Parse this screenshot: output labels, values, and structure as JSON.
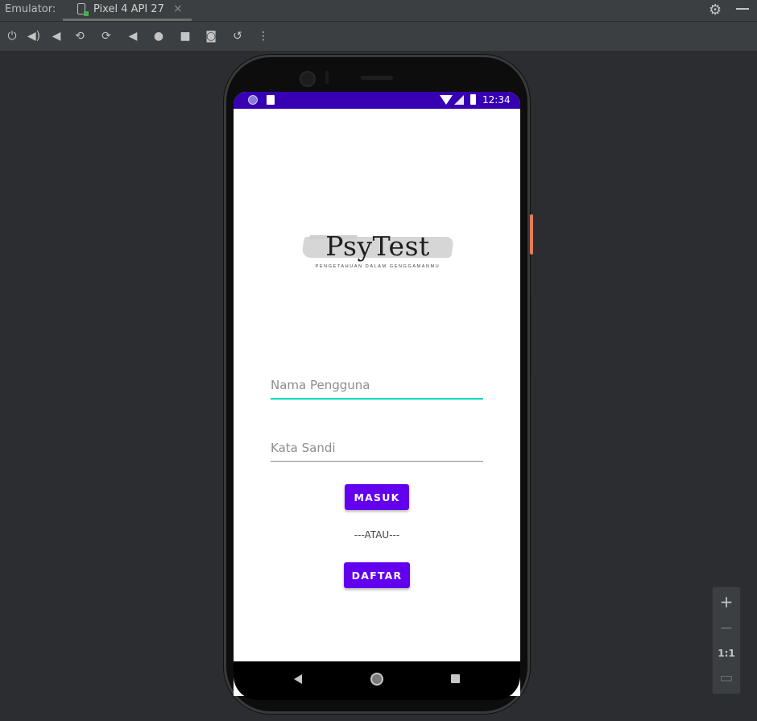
{
  "ide": {
    "panel_label": "Emulator:",
    "tab_name": "Pixel 4 API 27",
    "tab_close": "×",
    "settings_icon": "gear-icon",
    "minimize_icon": "minimize-icon"
  },
  "toolbar": {
    "items": [
      {
        "name": "power-icon",
        "glyph": "⏻"
      },
      {
        "name": "volume-up-icon",
        "glyph": "🔊"
      },
      {
        "name": "volume-down-icon",
        "glyph": "🔉"
      },
      {
        "name": "rotate-left-icon",
        "glyph": "⟲"
      },
      {
        "name": "rotate-right-icon",
        "glyph": "⟳"
      },
      {
        "name": "back-icon",
        "glyph": "◀"
      },
      {
        "name": "home-icon",
        "glyph": "●"
      },
      {
        "name": "overview-icon",
        "glyph": "■"
      },
      {
        "name": "screenshot-icon",
        "glyph": "📷"
      },
      {
        "name": "snapshot-icon",
        "glyph": "↺"
      },
      {
        "name": "more-icon",
        "glyph": "⋮"
      }
    ]
  },
  "device": {
    "status_time": "12:34",
    "app": {
      "logo_title": "PsyTest",
      "logo_subtitle": "PENGETAHUAN DALAM GENGGAMANMU",
      "username_placeholder": "Nama Pengguna",
      "password_placeholder": "Kata Sandi",
      "login_label": "MASUK",
      "or_label": "---ATAU---",
      "register_label": "DAFTAR"
    },
    "colors": {
      "status_bar": "#3700b3",
      "primary": "#6200ee",
      "accent": "#03dac5"
    }
  },
  "zoom": {
    "zoom_in": "+",
    "zoom_out": "−",
    "actual_size": "1:1",
    "fit": "▭"
  }
}
